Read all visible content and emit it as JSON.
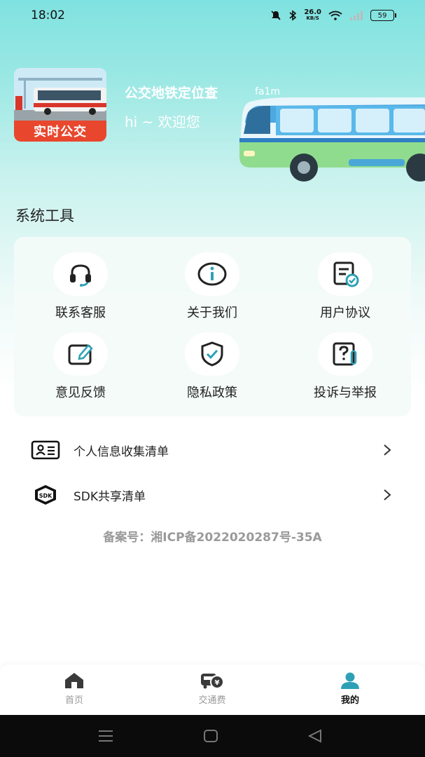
{
  "status_bar": {
    "time": "18:02",
    "net_speed_value": "26.0",
    "net_speed_unit": "KB/S",
    "battery": "59"
  },
  "header": {
    "logo_text": "实时公交",
    "app_name": "公交地铁定位查",
    "version_tag": "fa1m",
    "welcome": "hi ~ 欢迎您"
  },
  "tools": {
    "section_title": "系统工具",
    "items": [
      {
        "label": "联系客服",
        "icon": "headset-icon"
      },
      {
        "label": "关于我们",
        "icon": "info-icon"
      },
      {
        "label": "用户协议",
        "icon": "agreement-icon"
      },
      {
        "label": "意见反馈",
        "icon": "feedback-edit-icon"
      },
      {
        "label": "隐私政策",
        "icon": "shield-check-icon"
      },
      {
        "label": "投诉与举报",
        "icon": "report-icon"
      }
    ]
  },
  "list": {
    "items": [
      {
        "label": "个人信息收集清单",
        "icon": "id-card-icon"
      },
      {
        "label": "SDK共享清单",
        "icon": "sdk-box-icon"
      }
    ]
  },
  "icp": "备案号：湘ICP备2022020287号-35A",
  "tab_bar": {
    "tabs": [
      {
        "label": "首页",
        "icon": "home-icon"
      },
      {
        "label": "交通费",
        "icon": "bus-fare-icon"
      },
      {
        "label": "我的",
        "icon": "user-icon",
        "active": true
      }
    ]
  },
  "colors": {
    "accent": "#2ea0b6",
    "hero_top": "#7fe2e0",
    "logo_banner": "#e8472e"
  }
}
